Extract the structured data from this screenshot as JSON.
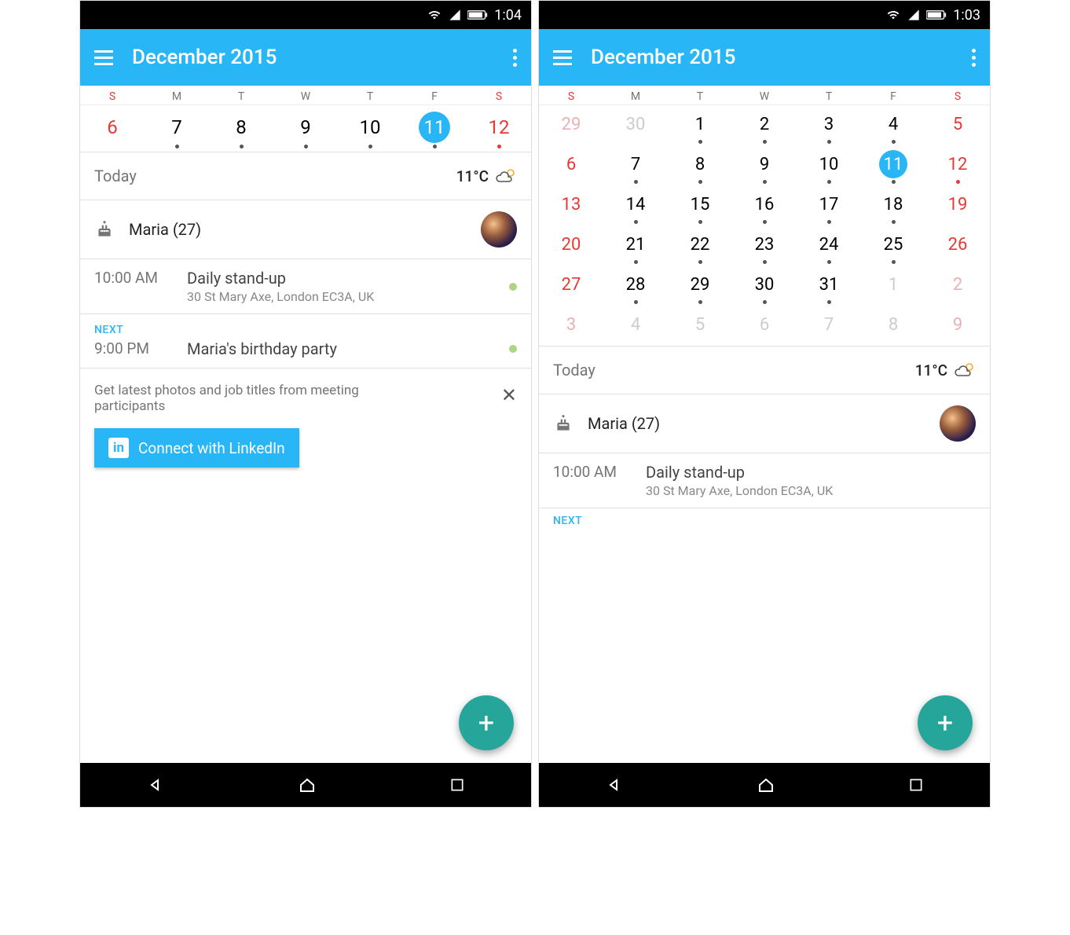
{
  "left": {
    "status_time": "1:04",
    "app_title": "December 2015",
    "dow": [
      "S",
      "M",
      "T",
      "W",
      "T",
      "F",
      "S"
    ],
    "week": [
      {
        "n": "6",
        "red": true,
        "dot": false
      },
      {
        "n": "7",
        "dot": true
      },
      {
        "n": "8",
        "dot": true
      },
      {
        "n": "9",
        "dot": true
      },
      {
        "n": "10",
        "dot": true
      },
      {
        "n": "11",
        "dot": true,
        "selected": true
      },
      {
        "n": "12",
        "red": true,
        "dot": true,
        "dotred": true
      }
    ],
    "today_label": "Today",
    "temperature": "11°C",
    "birthday_name": "Maria (27)",
    "event1_time": "10:00 AM",
    "event1_title": "Daily stand-up",
    "event1_sub": "30 St Mary Axe, London EC3A, UK",
    "next_label": "NEXT",
    "event2_time": "9:00 PM",
    "event2_title": "Maria's birthday party",
    "promo_text": "Get latest photos and job titles from meeting participants",
    "linkedin_label": "Connect with LinkedIn"
  },
  "right": {
    "status_time": "1:03",
    "app_title": "December 2015",
    "dow": [
      "S",
      "M",
      "T",
      "W",
      "T",
      "F",
      "S"
    ],
    "month": [
      [
        {
          "n": "29",
          "faded": true,
          "red": true
        },
        {
          "n": "30",
          "faded": true
        },
        {
          "n": "1",
          "dot": true
        },
        {
          "n": "2",
          "dot": true
        },
        {
          "n": "3",
          "dot": true
        },
        {
          "n": "4",
          "dot": true
        },
        {
          "n": "5",
          "red": true
        }
      ],
      [
        {
          "n": "6",
          "red": true
        },
        {
          "n": "7",
          "dot": true
        },
        {
          "n": "8",
          "dot": true
        },
        {
          "n": "9",
          "dot": true
        },
        {
          "n": "10",
          "dot": true
        },
        {
          "n": "11",
          "dot": true,
          "selected": true
        },
        {
          "n": "12",
          "red": true,
          "dot": true,
          "dotred": true
        }
      ],
      [
        {
          "n": "13",
          "red": true
        },
        {
          "n": "14",
          "dot": true
        },
        {
          "n": "15",
          "dot": true
        },
        {
          "n": "16",
          "dot": true
        },
        {
          "n": "17",
          "dot": true
        },
        {
          "n": "18",
          "dot": true
        },
        {
          "n": "19",
          "red": true
        }
      ],
      [
        {
          "n": "20",
          "red": true
        },
        {
          "n": "21",
          "dot": true
        },
        {
          "n": "22",
          "dot": true
        },
        {
          "n": "23",
          "dot": true
        },
        {
          "n": "24",
          "dot": true
        },
        {
          "n": "25",
          "dot": true
        },
        {
          "n": "26",
          "red": true
        }
      ],
      [
        {
          "n": "27",
          "red": true
        },
        {
          "n": "28",
          "dot": true
        },
        {
          "n": "29",
          "dot": true
        },
        {
          "n": "30",
          "dot": true
        },
        {
          "n": "31",
          "dot": true
        },
        {
          "n": "1",
          "faded": true
        },
        {
          "n": "2",
          "faded": true,
          "red": true
        }
      ],
      [
        {
          "n": "3",
          "faded": true,
          "red": true
        },
        {
          "n": "4",
          "faded": true
        },
        {
          "n": "5",
          "faded": true
        },
        {
          "n": "6",
          "faded": true
        },
        {
          "n": "7",
          "faded": true
        },
        {
          "n": "8",
          "faded": true
        },
        {
          "n": "9",
          "faded": true,
          "red": true
        }
      ]
    ],
    "today_label": "Today",
    "temperature": "11°C",
    "birthday_name": "Maria (27)",
    "event1_time": "10:00 AM",
    "event1_title": "Daily stand-up",
    "event1_sub": "30 St Mary Axe, London EC3A, UK",
    "next_label": "NEXT"
  }
}
